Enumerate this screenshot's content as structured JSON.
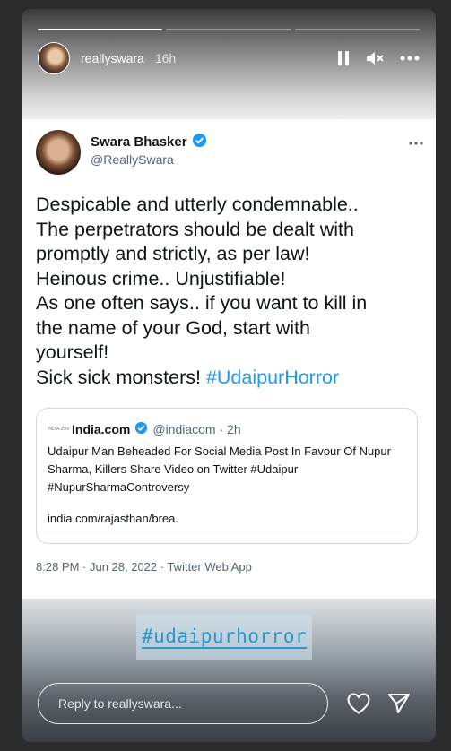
{
  "story": {
    "username": "reallyswara",
    "time": "16h",
    "progress_segments": [
      1,
      0,
      0
    ],
    "icons": {
      "pause": "pause-icon",
      "mute": "mute-icon",
      "more": "more-icon"
    },
    "sticker_hashtag": "#udaipurhorror"
  },
  "tweet": {
    "name": "Swara Bhasker",
    "handle": "@ReallySwara",
    "lines": [
      "Despicable and utterly condemnable..",
      "The perpetrators should be dealt with",
      "promptly and strictly, as per law!",
      "Heinous crime.. Unjustifiable!",
      "As one often says.. if you want to kill in",
      "the name of your God, start with",
      "yourself!"
    ],
    "last_line_prefix": "Sick sick monsters! ",
    "hashtag": "#UdaipurHorror",
    "meta": "8:28 PM · Jun 28, 2022 · Twitter Web App",
    "quote": {
      "logo_text": "INDIA.com",
      "name": "India.com",
      "handle_time": "@indiacom · 2h",
      "text": "Udaipur Man Beheaded For Social Media Post In Favour Of Nupur Sharma, Killers Share Video on Twitter #Udaipur #NupurSharmaControversy",
      "link": "india.com/rajasthan/brea."
    }
  },
  "reply": {
    "placeholder": "Reply to reallyswara..."
  },
  "colors": {
    "twitter_blue": "#1d9bf0",
    "verified": "#1d9bf0",
    "sticker_text": "#2a95c9"
  }
}
